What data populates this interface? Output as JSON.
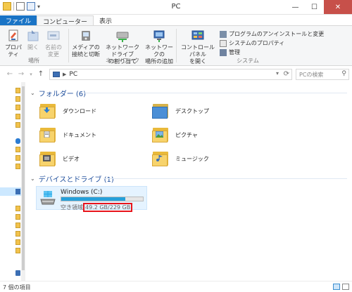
{
  "window": {
    "title": "PC",
    "minimize": "—",
    "maximize": "☐",
    "close": "✕"
  },
  "tabs": {
    "file": "ファイル",
    "computer": "コンピューター",
    "view": "表示"
  },
  "ribbon": {
    "location": {
      "group_label": "場所",
      "properties": "プロパティ",
      "open": "開く",
      "rename_1": "名前の",
      "rename_2": "変更"
    },
    "network": {
      "group_label": "ネットワーク",
      "media_1": "メディアの",
      "media_2": "接続と切断",
      "map_drive_1": "ネットワーク ドライブ",
      "map_drive_2": "の割り当て",
      "add_location_1": "ネットワークの",
      "add_location_2": "場所の追加"
    },
    "system": {
      "group_label": "システム",
      "control_panel_1": "コントロール パネル",
      "control_panel_2": "を開く",
      "uninstall": "プログラムのアンインストールと変更",
      "system_properties": "システムのプロパティ",
      "manage": "管理"
    }
  },
  "navbar": {
    "address": "PC",
    "search_placeholder": "PCの検索"
  },
  "folders": {
    "header": "フォルダー (6)",
    "items": [
      {
        "label": "ダウンロード"
      },
      {
        "label": "デスクトップ"
      },
      {
        "label": "ドキュメント"
      },
      {
        "label": "ピクチャ"
      },
      {
        "label": "ビデオ"
      },
      {
        "label": "ミュージック"
      }
    ]
  },
  "devices": {
    "header": "デバイスとドライブ (1)",
    "drive": {
      "name": "Windows (C:)",
      "free_prefix": "空き領域",
      "free_value": "49.2 GB/229 GB",
      "used_fraction": 0.785
    }
  },
  "status": {
    "count": "7 個の項目"
  },
  "colors": {
    "file_tab": "#1a74c6",
    "accent": "#1e4e9c",
    "highlight": "#e8141b",
    "drive_bar": "#26a0da"
  }
}
